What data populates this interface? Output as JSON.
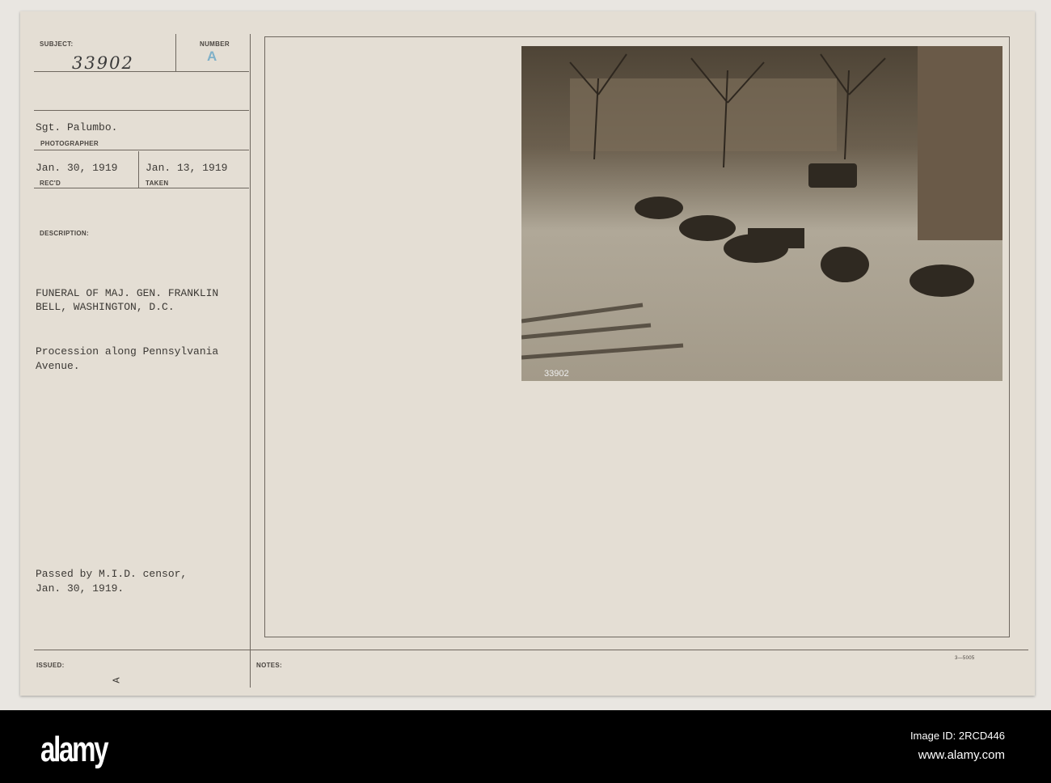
{
  "card": {
    "subject_label": "SUBJECT:",
    "subject_number": "33902",
    "number_label": "NUMBER",
    "number_stamp": "A",
    "photographer": "Sgt. Palumbo.",
    "photographer_label": "PHOTOGRAPHER",
    "received_date": "Jan. 30, 1919",
    "received_label": "REC'D",
    "taken_date": "Jan. 13, 1919",
    "taken_label": "TAKEN",
    "description_label": "DESCRIPTION:",
    "description_title": "FUNERAL OF MAJ. GEN. FRANKLIN\nBELL, WASHINGTON, D.C.",
    "description_body": "Procession along Pennsylvania\nAvenue.",
    "censor_note": "Passed by M.I.D. censor,\nJan. 30, 1919.",
    "issued_label": "ISSUED:",
    "issued_mark": "A",
    "notes_label": "NOTES:",
    "form_number": "3—5005",
    "photo_caption": "33902"
  },
  "footer": {
    "logo": "alamy",
    "image_id": "Image ID: 2RCD446",
    "url": "www.alamy.com"
  }
}
